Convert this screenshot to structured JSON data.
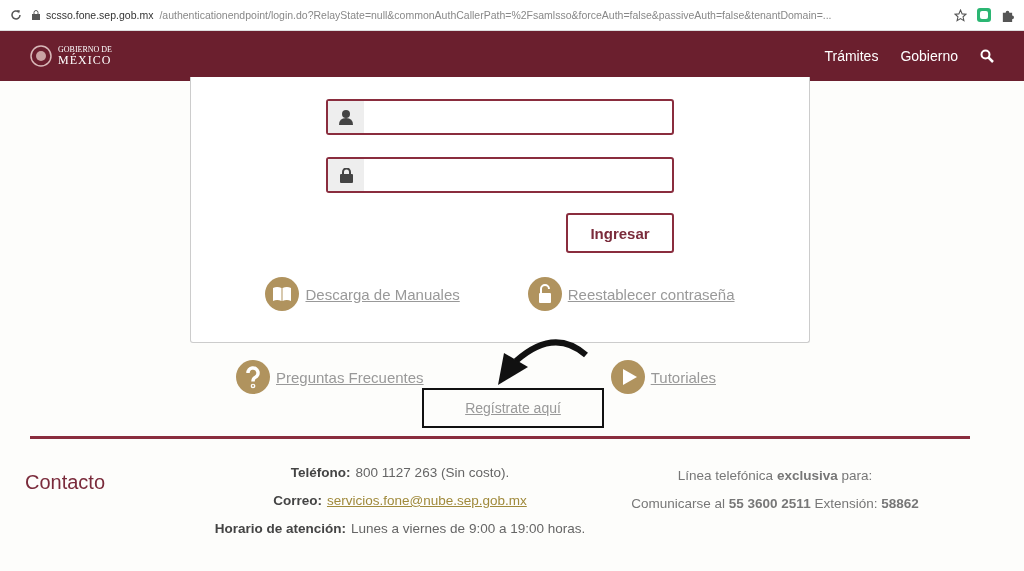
{
  "browser": {
    "host": "scsso.fone.sep.gob.mx",
    "path": "/authenticationendpoint/login.do?RelayState=null&commonAuthCallerPath=%2Fsamlsso&forceAuth=false&passiveAuth=false&tenantDomain=..."
  },
  "header": {
    "logo_top": "GOBIERNO DE",
    "logo_bottom": "MÉXICO",
    "nav": [
      "Trámites",
      "Gobierno"
    ]
  },
  "login": {
    "fields": [
      {
        "kind": "user"
      },
      {
        "kind": "password"
      }
    ],
    "button": "Ingresar",
    "links": [
      {
        "kind": "book",
        "label": "Descarga de Manuales"
      },
      {
        "kind": "unlock",
        "label": "Reestablecer contraseña"
      }
    ]
  },
  "help_links": [
    {
      "kind": "question",
      "label": "Preguntas Frecuentes"
    },
    {
      "kind": "play",
      "label": "Tutoriales"
    }
  ],
  "register": {
    "label": "Regístrate aquí",
    "highlighted": true
  },
  "footer": {
    "title": "Contacto",
    "lines": [
      {
        "label": "Teléfono:",
        "value": "800 1127 263 (Sin costo).",
        "link": false
      },
      {
        "label": "Correo:",
        "value": "servicios.fone@nube.sep.gob.mx",
        "link": true
      },
      {
        "label": "Horario de atención:",
        "value": "Lunes a viernes de 9:00 a 19:00 horas.",
        "link": false
      }
    ],
    "hotline": [
      "Línea telefónica **exclusiva** para:",
      "Comunicarse al **55 3600 2511** Extensión: **58862**"
    ]
  }
}
